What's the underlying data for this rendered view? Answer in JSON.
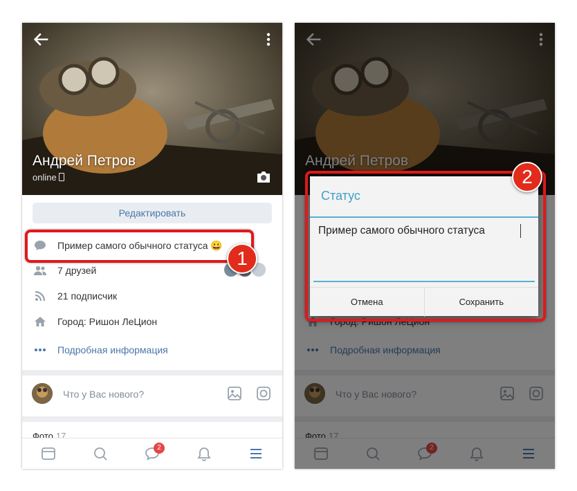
{
  "profile": {
    "name": "Андрей Петров",
    "status_online": "online",
    "edit_label": "Редактировать",
    "status_text": "Пример самого обычного статуса 😀",
    "friends": "7 друзей",
    "followers": "21 подписчик",
    "city": "Город: Ришон ЛеЦион",
    "details_link": "Подробная информация",
    "composer_placeholder": "Что у Вас нового?",
    "photos_label": "Фото",
    "photos_count": "17"
  },
  "tabbar": {
    "messages_badge": "2"
  },
  "dialog": {
    "title": "Статус",
    "input_value": "Пример самого обычного статуса",
    "cancel_label": "Отмена",
    "save_label": "Сохранить"
  },
  "steps": [
    "1",
    "2"
  ],
  "colors": {
    "accent": "#4a76a8",
    "highlight": "#e0181b",
    "dialog_accent": "#3fa0c6",
    "badge": "#e64646"
  }
}
